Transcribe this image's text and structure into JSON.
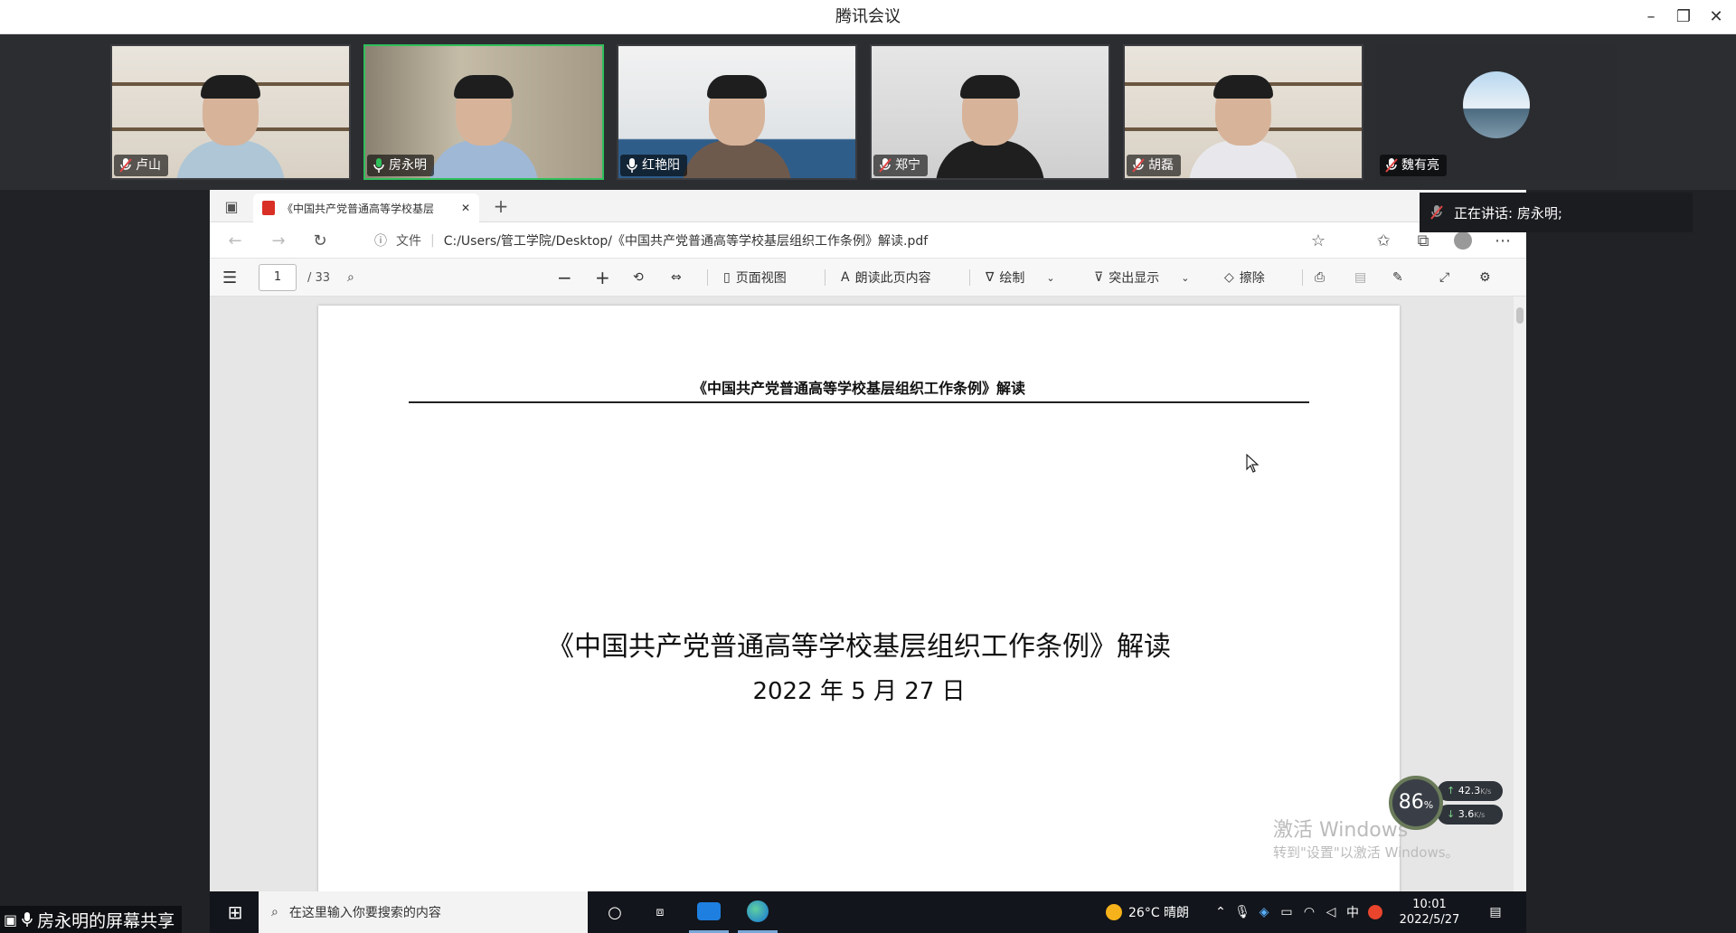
{
  "app": {
    "title": "腾讯会议"
  },
  "participants": [
    {
      "name": "卢山",
      "muted": true
    },
    {
      "name": "房永明",
      "muted": false,
      "active": true
    },
    {
      "name": "红艳阳",
      "muted": false
    },
    {
      "name": "郑宁",
      "muted": true
    },
    {
      "name": "胡磊",
      "muted": true
    },
    {
      "name": "魏有亮",
      "muted": true
    }
  ],
  "speaking": {
    "text": "正在讲话: 房永明;"
  },
  "browser": {
    "tab_title": "《中国共产党普通高等学校基层",
    "url_scheme_label": "文件",
    "url": "C:/Users/管工学院/Desktop/《中国共产党普通高等学校基层组织工作条例》解读.pdf"
  },
  "pdf_toolbar": {
    "page_current": "1",
    "page_total": "/ 33",
    "page_view": "页面视图",
    "read_aloud": "朗读此页内容",
    "draw": "绘制",
    "highlight": "突出显示",
    "erase": "擦除"
  },
  "document": {
    "header": "《中国共产党普通高等学校基层组织工作条例》解读",
    "title": "《中国共产党普通高等学校基层组织工作条例》解读",
    "date": "2022 年 5 月 27 日"
  },
  "speed_widget": {
    "percent": "86",
    "percent_unit": "%",
    "up": "42.3",
    "down": "3.6",
    "unit": "K/s"
  },
  "watermark": {
    "line1": "激活 Windows",
    "line2": "转到\"设置\"以激活 Windows。"
  },
  "taskbar": {
    "search_placeholder": "在这里输入你要搜索的内容",
    "weather": "26°C 晴朗",
    "ime": "中",
    "time": "10:01",
    "date": "2022/5/27"
  },
  "share_label": "房永明的屏幕共享",
  "colors": {
    "active_border": "#2fbf5b",
    "muted_mic": "#e04545",
    "taskbar": "#12151b"
  }
}
